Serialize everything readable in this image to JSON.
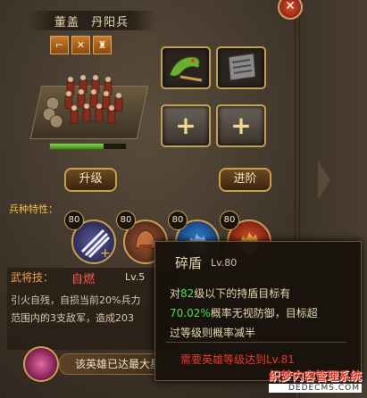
{
  "header": {
    "general_name": "董盖",
    "unit_name": "丹阳兵"
  },
  "type_icons": [
    "boot-icon",
    "crossed-weapons-icon",
    "armor-icon"
  ],
  "equipment": {
    "slots": [
      {
        "name": "dragon-weapon-slot",
        "state": "filled"
      },
      {
        "name": "scroll-slot",
        "state": "filled"
      },
      {
        "name": "empty-slot-1",
        "state": "empty",
        "symbol": "+"
      },
      {
        "name": "empty-slot-2",
        "state": "empty",
        "symbol": "+"
      }
    ]
  },
  "troop": {
    "hp_fraction": 0.7
  },
  "buttons": {
    "upgrade": "升级",
    "advance": "进阶"
  },
  "traits": {
    "label": "兵种特性：",
    "skills": [
      {
        "level": "80",
        "icon": "white-claw-icon"
      },
      {
        "level": "80",
        "icon": "armor-helm-icon"
      },
      {
        "level": "80",
        "icon": "blue-flame-icon"
      },
      {
        "level": "80",
        "icon": "red-fire-icon"
      }
    ]
  },
  "general_skill": {
    "label": "武将技：",
    "name": "自燃",
    "level": "Lv.5",
    "desc_line1": "引火自残，自损当前20%兵力",
    "desc_line2": "范围内的3支敌军，造成203"
  },
  "bottom": {
    "text": "该英雄已达最大星"
  },
  "tooltip": {
    "name": "碎盾",
    "level": "Lv.80",
    "line1_pre": "对",
    "line1_num": "82",
    "line1_post": "级以下的持盾目标有",
    "line2_num": "70.02%",
    "line2_post": "概率无视防御，目标超",
    "line3": "过等级则概率减半",
    "requirement": "需要英雄等级达到Lv.81"
  },
  "watermark": {
    "line1": "织梦内容管理系统",
    "line2": "DEDECMS.COM"
  },
  "colors": {
    "gold_border": "#c9a04a",
    "highlight_green": "#4ae04a",
    "warning_red": "#e83a2a"
  }
}
